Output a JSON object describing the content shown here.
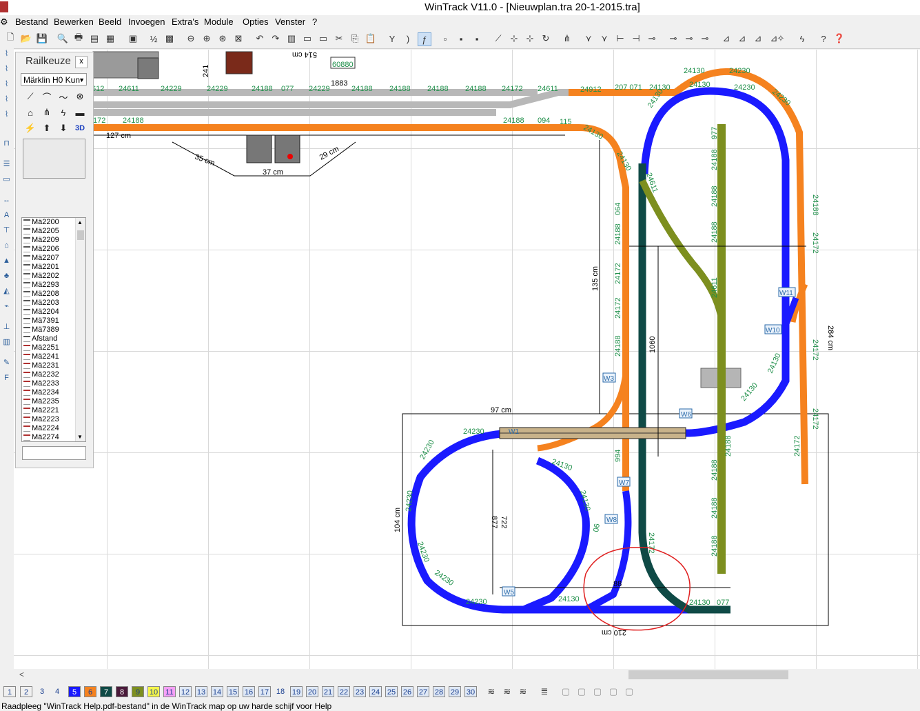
{
  "window": {
    "title": "WinTrack  V11.0 - [Nieuwplan.tra 20-1-2015.tra]"
  },
  "menu": [
    "Bestand",
    "Bewerken",
    "Beeld",
    "Invoegen",
    "Extra's",
    "Module",
    "Opties",
    "Venster",
    "?"
  ],
  "panel": {
    "title": "Railkeuze",
    "close": "x",
    "catalog": "Märklin H0 Kun",
    "tools_3d": "3D",
    "items": [
      "Mä2200",
      "Mä2205",
      "Mä2209",
      "Mä2206",
      "Mä2207",
      "Mä2201",
      "Mä2202",
      "Mä2293",
      "Mä2208",
      "Mä2203",
      "Mä2204",
      "Mä7391",
      "Mä7389",
      "Afstand",
      "Mä2251",
      "Mä2241",
      "Mä2231",
      "Mä2232",
      "Mä2233",
      "Mä2234",
      "Mä2235",
      "Mä2221",
      "Mä2223",
      "Mä2224",
      "Mä2274"
    ]
  },
  "layers": [
    "1",
    "2",
    "3",
    "4",
    "5",
    "6",
    "7",
    "8",
    "9",
    "10",
    "11",
    "12",
    "13",
    "14",
    "15",
    "16",
    "17",
    "18",
    "19",
    "20",
    "21",
    "22",
    "23",
    "24",
    "25",
    "26",
    "27",
    "28",
    "29",
    "30"
  ],
  "status": "Raadpleeg \"WinTrack Help.pdf-bestand\" in de WinTrack map op uw harde schijf voor Help",
  "plan": {
    "colors": {
      "orange": "#f5821f",
      "blue": "#1a1aff",
      "olive": "#7d8f1f",
      "darkgreen": "#0f4a46",
      "grey": "#b8b8b8",
      "annotation": "#e02020"
    },
    "dims": {
      "d127": "127 cm",
      "d35": "35 cm",
      "d29": "29 cm",
      "d37": "37 cm",
      "d135": "135 cm",
      "d284": "284 cm",
      "d97": "97 cm",
      "d104": "104 cm",
      "d210": "210 cm",
      "d1883": "1883",
      "d60880": "60880",
      "d514": "514 cm",
      "d241": "241"
    },
    "track_labels": {
      "l24611a": "24611",
      "l24229a": "24229",
      "l24229b": "24229",
      "l24188a": "24188",
      "l077a": "077",
      "l24229c": "24229",
      "l24188b": "24188",
      "l24188c": "24188",
      "l24188d": "24188",
      "l24188e": "24188",
      "l24172a": "24172",
      "l24611b": "24611",
      "l24912": "24912",
      "l207071": "207 071",
      "l24130a": "24130",
      "l24130b": "24130",
      "l24230a": "24230",
      "l24130c": "24130",
      "l24230b": "24230",
      "l24230c": "24230",
      "l172": "172",
      "l24188f": "24188",
      "l094": "094",
      "l115": "115",
      "l24130d": "24130",
      "l24130e": "24130",
      "l24130f": "24130",
      "l24611c": "24611",
      "l064": "064",
      "l24188g": "24188",
      "l24172b": "24172",
      "l24172c": "24172",
      "l24188h": "24188",
      "l977": "977",
      "l24188i": "24188",
      "l24188j": "24188",
      "l24188k": "24188",
      "l24172d": "24172",
      "l24188l": "24188",
      "l24172e": "24172",
      "l24172f": "24172",
      "l24172g": "24172",
      "l24130g": "24130",
      "l24130h": "24130",
      "l24230d": "24230",
      "l24230e": "24230",
      "l24230f": "24230",
      "l24230g": "24230",
      "l24230h": "24230",
      "l24230i": "24230",
      "l24130i": "24130",
      "l24130j": "24130",
      "l24130k": "24130",
      "l077b": "077",
      "l24172h": "24172",
      "l24188m": "24188",
      "l24188n": "24188",
      "l24188o": "24188",
      "l994": "994",
      "l24611d": "24611",
      "l1060": "1060",
      "l722": "722",
      "l877": "877",
      "l88": "88",
      "l06": "06",
      "lW1": "W1",
      "lW3": "W3",
      "lW5": "W5",
      "lW6": "W6",
      "lW7": "W7",
      "lW8": "W8",
      "lW10": "W10",
      "lW11": "W11",
      "l24130l": "24130",
      "l24188p": "24188",
      "l612": "612",
      "l24188q": "24188"
    }
  }
}
